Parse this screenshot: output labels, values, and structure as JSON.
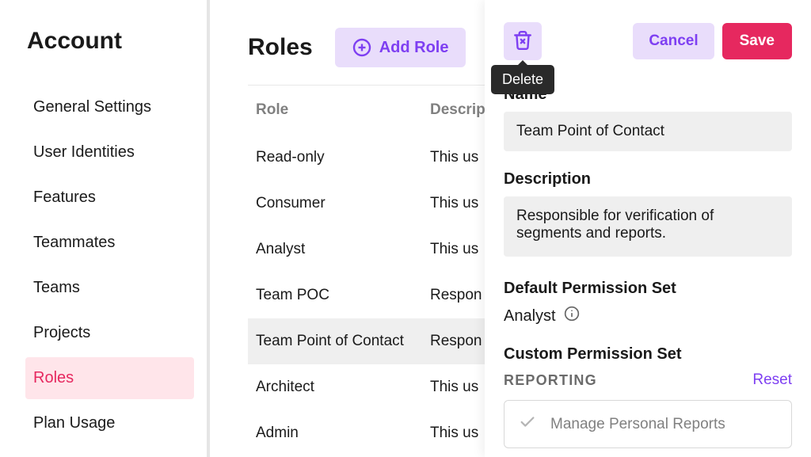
{
  "sidebar": {
    "title": "Account",
    "items": [
      {
        "label": "General Settings"
      },
      {
        "label": "User Identities"
      },
      {
        "label": "Features"
      },
      {
        "label": "Teammates"
      },
      {
        "label": "Teams"
      },
      {
        "label": "Projects"
      },
      {
        "label": "Roles"
      },
      {
        "label": "Plan Usage"
      }
    ]
  },
  "main": {
    "title": "Roles",
    "add_role_label": "Add Role",
    "table": {
      "col_role": "Role",
      "col_description": "Description",
      "rows": [
        {
          "role": "Read-only",
          "desc": "This us"
        },
        {
          "role": "Consumer",
          "desc": "This us"
        },
        {
          "role": "Analyst",
          "desc": "This us"
        },
        {
          "role": "Team POC",
          "desc": "Respon"
        },
        {
          "role": "Team Point of Contact",
          "desc": "Respon"
        },
        {
          "role": "Architect",
          "desc": "This us"
        },
        {
          "role": "Admin",
          "desc": "This us"
        }
      ]
    }
  },
  "panel": {
    "delete_tooltip": "Delete",
    "cancel_label": "Cancel",
    "save_label": "Save",
    "name_label": "Name",
    "name_value": "Team Point of Contact",
    "description_label": "Description",
    "description_value": "Responsible for verification of segments and reports.",
    "default_perm_label": "Default Permission Set",
    "default_perm_value": "Analyst",
    "custom_perm_label": "Custom Permission Set",
    "section_reporting": "REPORTING",
    "reset_label": "Reset",
    "permissions": [
      {
        "label": "Manage Personal Reports"
      }
    ]
  }
}
